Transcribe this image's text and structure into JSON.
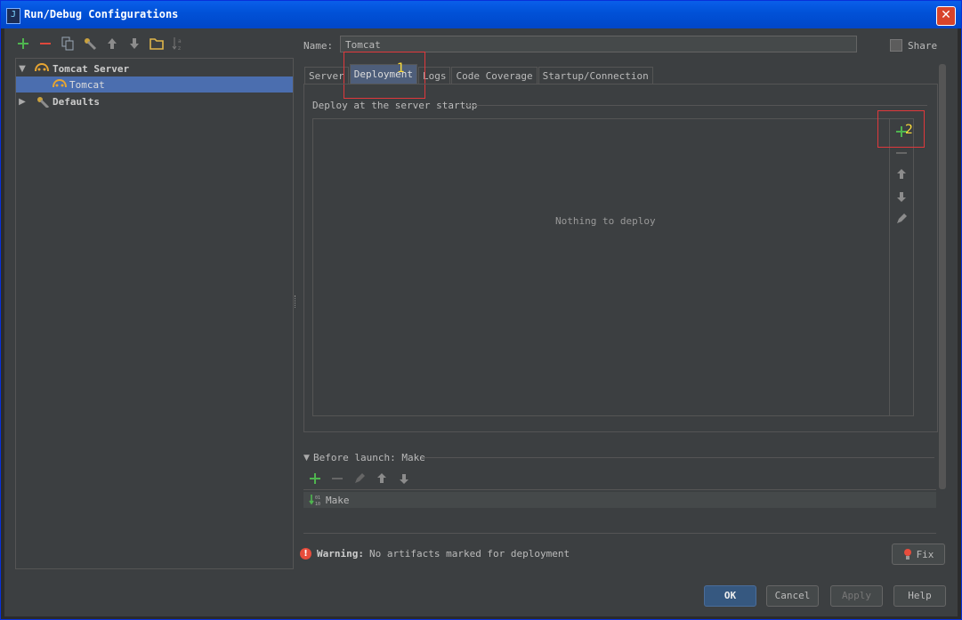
{
  "window": {
    "title": "Run/Debug Configurations",
    "app_icon": "J"
  },
  "left_toolbar": [
    {
      "name": "add-config-button",
      "icon": "plus-icon",
      "color": "#4fb54f"
    },
    {
      "name": "remove-config-button",
      "icon": "minus-icon",
      "color": "#e0483c"
    },
    {
      "name": "copy-config-button",
      "icon": "copy-icon",
      "color": "#9aa7b5"
    },
    {
      "name": "edit-defaults-button",
      "icon": "wrench-icon",
      "color": "#c9a13e"
    },
    {
      "name": "move-up-button",
      "icon": "arrow-up-icon",
      "color": "#8c8c8c"
    },
    {
      "name": "move-down-button",
      "icon": "arrow-down-icon",
      "color": "#8c8c8c"
    },
    {
      "name": "folder-button",
      "icon": "folder-icon",
      "color": "#e0b64a"
    },
    {
      "name": "sort-button",
      "icon": "sort-az-icon",
      "color": "#777777"
    }
  ],
  "tree": {
    "group": "Tomcat Server",
    "item": "Tomcat",
    "defaults": "Defaults"
  },
  "name_field": {
    "label": "Name:",
    "value": "Tomcat"
  },
  "share_label": "Share",
  "tabs": [
    "Server",
    "Deployment",
    "Logs",
    "Code Coverage",
    "Startup/Connection"
  ],
  "active_tab": "Deployment",
  "deploy": {
    "section_label": "Deploy at the server startup",
    "empty_text": "Nothing to deploy"
  },
  "annotations": {
    "first": "1",
    "second": "2"
  },
  "before_launch": {
    "label": "Before launch: Make",
    "item": "Make"
  },
  "warning": {
    "title": "Warning:",
    "text": "No artifacts marked for deployment"
  },
  "buttons": {
    "fix": "Fix",
    "ok": "OK",
    "cancel": "Cancel",
    "apply": "Apply",
    "help": "Help"
  },
  "colors": {
    "accent": "#4b6eaf",
    "annotation_box": "#e0383c",
    "annotation_text": "#ffdf3a"
  }
}
